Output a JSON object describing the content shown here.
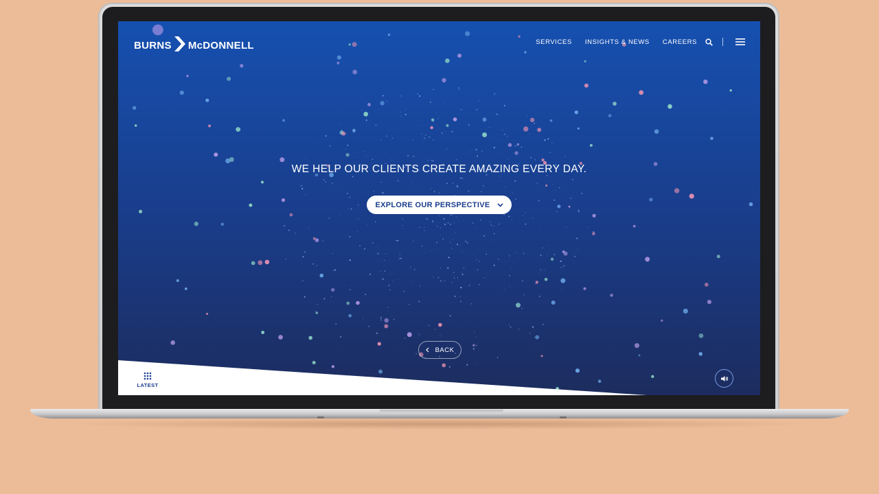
{
  "brand": {
    "left": "BURNS",
    "right": "McDONNELL"
  },
  "nav": {
    "services": "SERVICES",
    "insights": "INSIGHTS & NEWS",
    "careers": "CAREERS",
    "search_icon": "search-icon",
    "menu_icon": "hamburger-menu-icon"
  },
  "hero": {
    "headline": "WE HELP OUR CLIENTS CREATE AMAZING EVERY DAY.",
    "cta_label": "EXPLORE OUR PERSPECTIVE",
    "back_label": "BACK"
  },
  "footer": {
    "latest_label": "LATEST",
    "sound_icon": "speaker-icon"
  },
  "colors": {
    "page_background": "#ecbc98",
    "screen_top": "#1650b0",
    "screen_bottom": "#1c2c5e",
    "brand_blue": "#1a3d8c",
    "dot_colors": [
      "#8fd6c8",
      "#b49ae6",
      "#e891b2",
      "#6ba8e8"
    ]
  }
}
